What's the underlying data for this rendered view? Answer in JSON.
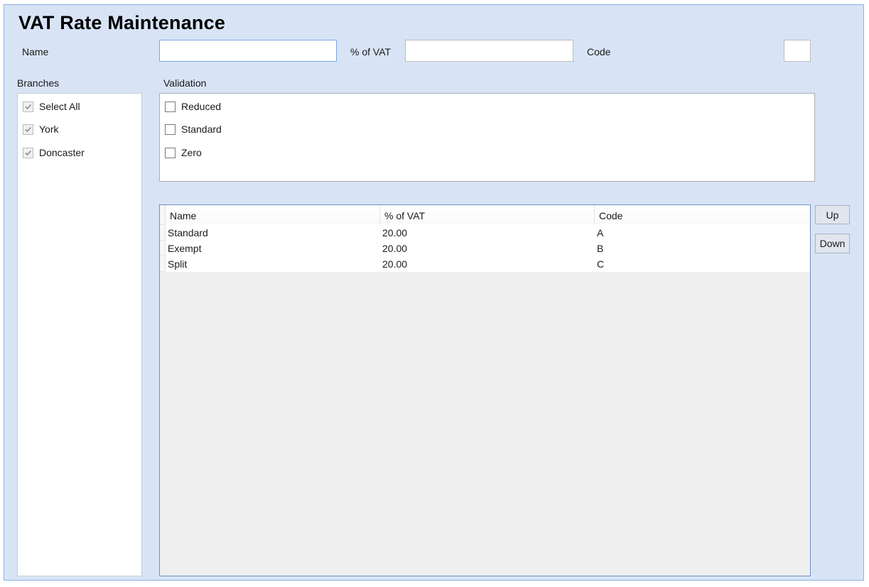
{
  "title": "VAT Rate Maintenance",
  "form": {
    "name_label": "Name",
    "name_value": "",
    "vat_label": "% of VAT",
    "vat_value": "",
    "code_label": "Code",
    "code_value": ""
  },
  "branches": {
    "label": "Branches",
    "items": [
      {
        "label": "Select All",
        "checked": true
      },
      {
        "label": "York",
        "checked": true
      },
      {
        "label": "Doncaster",
        "checked": true
      }
    ]
  },
  "validation": {
    "label": "Validation",
    "items": [
      {
        "label": "Reduced",
        "checked": false
      },
      {
        "label": "Standard",
        "checked": false
      },
      {
        "label": "Zero",
        "checked": false
      }
    ]
  },
  "grid": {
    "columns": [
      "Name",
      "% of VAT",
      "Code"
    ],
    "rows": [
      {
        "name": "Standard",
        "vat": "20.00",
        "code": "A"
      },
      {
        "name": "Exempt",
        "vat": "20.00",
        "code": "B"
      },
      {
        "name": "Split",
        "vat": "20.00",
        "code": "C"
      }
    ]
  },
  "buttons": {
    "up": "Up",
    "down": "Down"
  }
}
